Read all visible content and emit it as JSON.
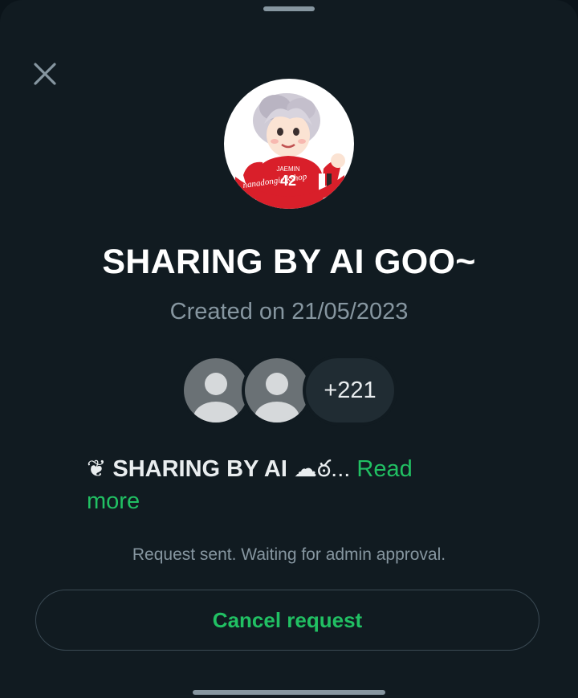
{
  "group": {
    "title": "SHARING BY AI GOO~",
    "created": "Created on 21/05/2023",
    "avatar_icon": "cartoon-avatar-icon",
    "avatar_jersey_number": "42",
    "avatar_jersey_name": "JAEMIN",
    "avatar_watermark": "nanadongie kshop"
  },
  "members": {
    "count_label": "+221",
    "avatar_icon": "default-person-icon"
  },
  "description": {
    "prefix_emoji": "❦",
    "text": "SHARING BY AI",
    "suffix_emoji": "☁ఠ",
    "ellipsis": "...",
    "read_more_label": "Read more"
  },
  "status": {
    "message": "Request sent. Waiting for admin approval."
  },
  "actions": {
    "cancel_label": "Cancel request"
  },
  "colors": {
    "background": "#111b21",
    "accent": "#21c063",
    "muted_text": "#8696a0",
    "chip": "#202c33"
  },
  "icons": {
    "close": "close-icon"
  }
}
